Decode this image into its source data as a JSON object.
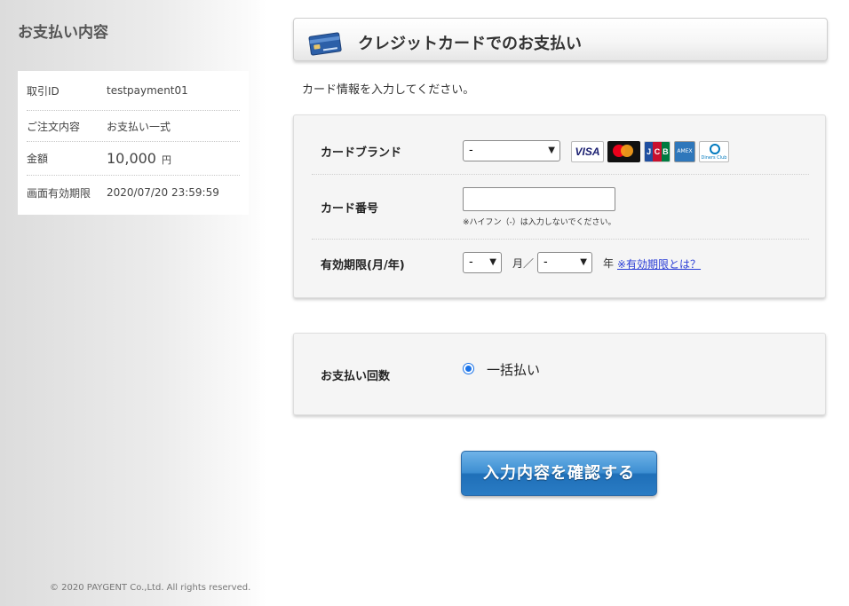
{
  "sidebar": {
    "title": "お支払い内容",
    "rows": [
      {
        "label": "取引ID",
        "value": "testpayment01"
      },
      {
        "label": "ご注文内容",
        "value": "お支払い一式"
      },
      {
        "label": "金額",
        "value": "10,000",
        "unit": "円"
      },
      {
        "label": "画面有効期限",
        "value": "2020/07/20 23:59:59"
      }
    ],
    "copyright": "© 2020 PAYGENT Co.,Ltd. All rights reserved."
  },
  "header": {
    "title": "クレジットカードでのお支払い",
    "icon": "credit-card-icon"
  },
  "intro": "カード情報を入力してください。",
  "card_form": {
    "brand_label": "カードブランド",
    "brand_value": "-",
    "brand_logos": [
      "VISA",
      "mastercard",
      "JCB",
      "AMERICAN EXPRESS",
      "Diners Club INTERNATIONAL"
    ],
    "number_label": "カード番号",
    "number_value": "",
    "number_hint": "※ハイフン（-）は入力しないでください。",
    "expiry_label": "有効期限(月/年)",
    "month_value": "-",
    "month_sep": "月／",
    "year_value": "-",
    "year_sep": "年",
    "expiry_link": "※有効期限とは？"
  },
  "payment": {
    "label": "お支払い回数",
    "option": "一括払い",
    "selected": true
  },
  "submit": {
    "label": "入力内容を確認する",
    "color": "#2a7cc4"
  }
}
